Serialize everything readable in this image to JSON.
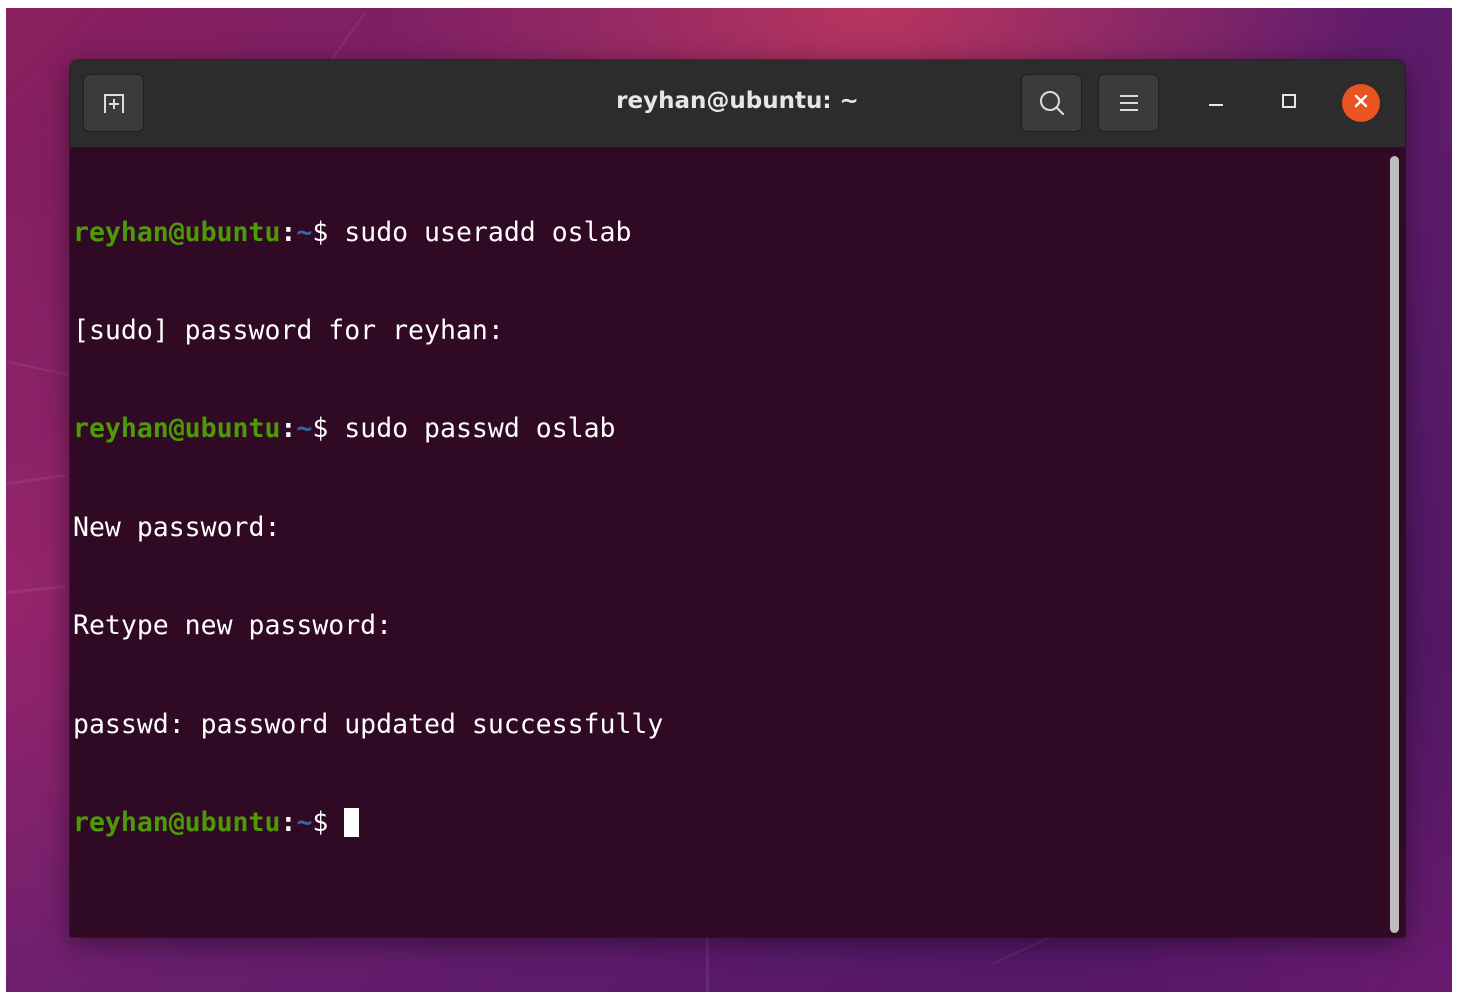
{
  "window": {
    "title": "reyhan@ubuntu: ~"
  },
  "headerbar": {
    "new_tab_icon": "new-tab-icon",
    "search_icon": "search-icon",
    "menu_icon": "hamburger-menu-icon",
    "minimize_icon": "minimize-icon",
    "maximize_icon": "maximize-icon",
    "close_icon": "close-icon"
  },
  "terminal": {
    "lines": [
      {
        "user": "reyhan@ubuntu",
        "colon": ":",
        "path": "~",
        "dollar": "$ ",
        "command": "sudo useradd oslab"
      },
      {
        "output": "[sudo] password for reyhan:"
      },
      {
        "user": "reyhan@ubuntu",
        "colon": ":",
        "path": "~",
        "dollar": "$ ",
        "command": "sudo passwd oslab"
      },
      {
        "output": "New password:"
      },
      {
        "output": "Retype new password:"
      },
      {
        "output": "passwd: password updated successfully"
      },
      {
        "user": "reyhan@ubuntu",
        "colon": ":",
        "path": "~",
        "dollar": "$ ",
        "command": ""
      }
    ]
  },
  "colors": {
    "terminal_background": "#300a24",
    "prompt_user": "#4e9a06",
    "prompt_path": "#3465a4",
    "close_button": "#e95420",
    "headerbar": "#2c2c2c"
  }
}
